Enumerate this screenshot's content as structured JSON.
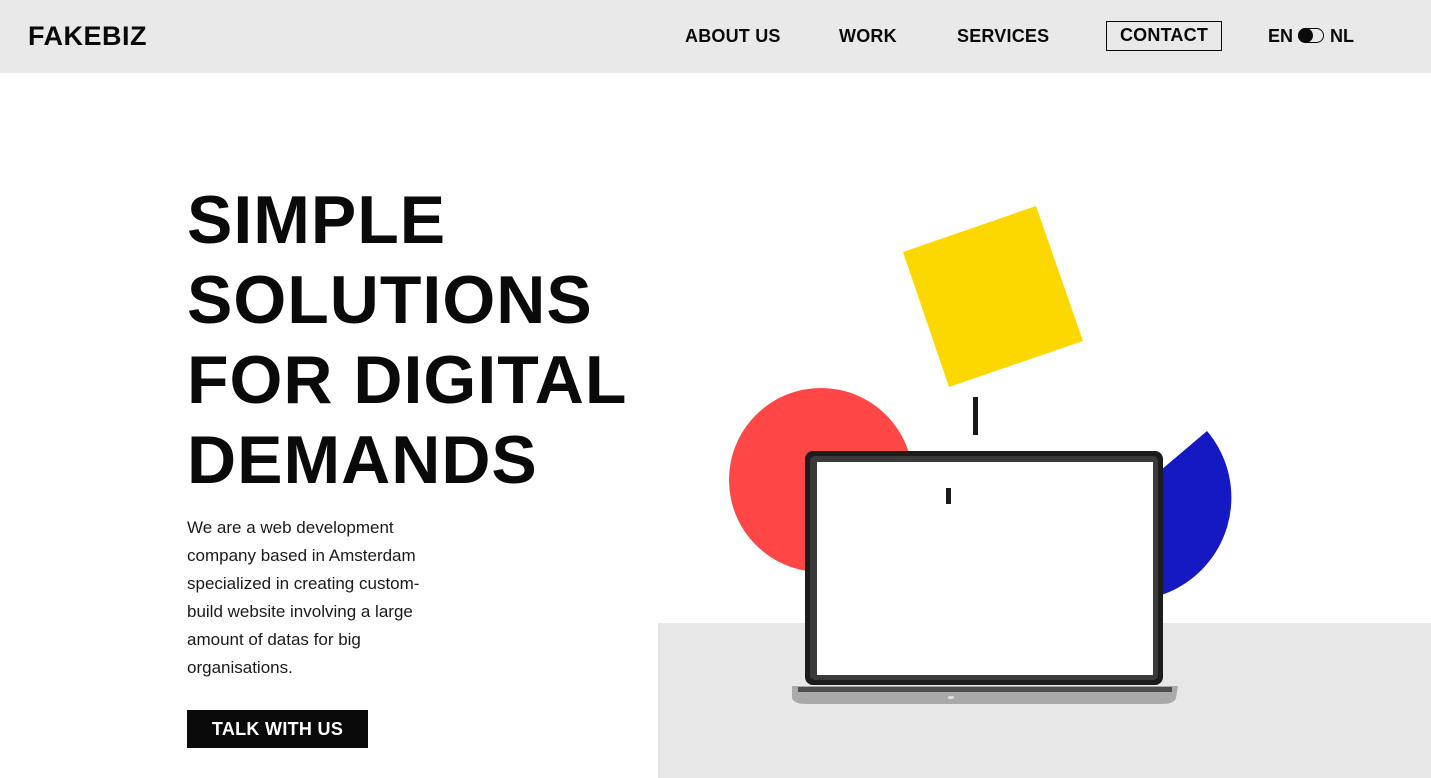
{
  "header": {
    "logo": "FAKEBIZ",
    "nav": {
      "about": "ABOUT US",
      "work": "WORK",
      "services": "SERVICES",
      "contact": "CONTACT"
    },
    "language": {
      "en": "EN",
      "nl": "NL",
      "selected": "EN"
    }
  },
  "hero": {
    "title_lines": [
      "SIMPLE",
      "SOLUTIONS",
      "FOR DIGITAL",
      "DEMANDS"
    ],
    "description": "We are a web development company based in Amsterdam specialized in creating custom-build website involving a large amount of datas for big organisations.",
    "cta_label": "TALK WITH US"
  },
  "illustration": {
    "icons": [
      "yellow-square-icon",
      "red-circle-icon",
      "blue-half-circle-icon",
      "laptop-icon"
    ],
    "colors": {
      "yellow": "#FDD800",
      "red": "#FF4747",
      "blue": "#1419C2",
      "floor": "#E7E7E7",
      "header_bg": "#E9E9E9"
    }
  }
}
